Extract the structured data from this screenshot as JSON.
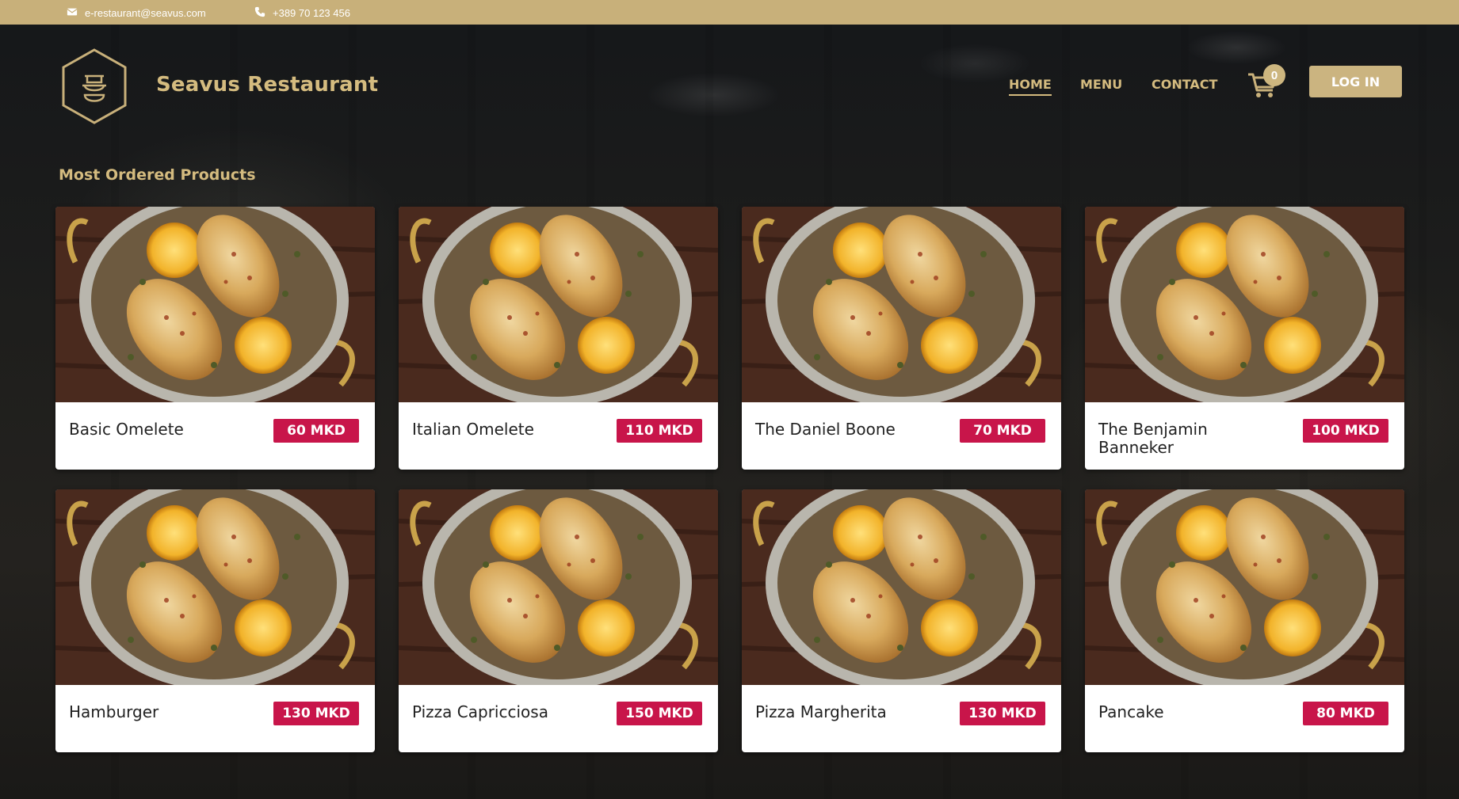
{
  "topbar": {
    "email": "e-restaurant@seavus.com",
    "phone": "+389 70 123 456"
  },
  "header": {
    "brand": "Seavus Restaurant",
    "nav": [
      {
        "label": "HOME",
        "active": true
      },
      {
        "label": "MENU",
        "active": false
      },
      {
        "label": "CONTACT",
        "active": false
      }
    ],
    "cart_count": "0",
    "login_label": "LOG IN"
  },
  "colors": {
    "gold": "#d4bb7f",
    "topbar": "#c8b07a",
    "price_badge": "#c8154a"
  },
  "section_title": "Most Ordered Products",
  "products": [
    {
      "name": "Basic Omelete",
      "price": "60 MKD"
    },
    {
      "name": "Italian Omelete",
      "price": "110 MKD"
    },
    {
      "name": "The Daniel Boone",
      "price": "70 MKD"
    },
    {
      "name": "The Benjamin Banneker",
      "price": "100 MKD"
    },
    {
      "name": "Hamburger",
      "price": "130 MKD"
    },
    {
      "name": "Pizza Capricciosa",
      "price": "150 MKD"
    },
    {
      "name": "Pizza Margherita",
      "price": "130 MKD"
    },
    {
      "name": "Pancake",
      "price": "80 MKD"
    }
  ]
}
